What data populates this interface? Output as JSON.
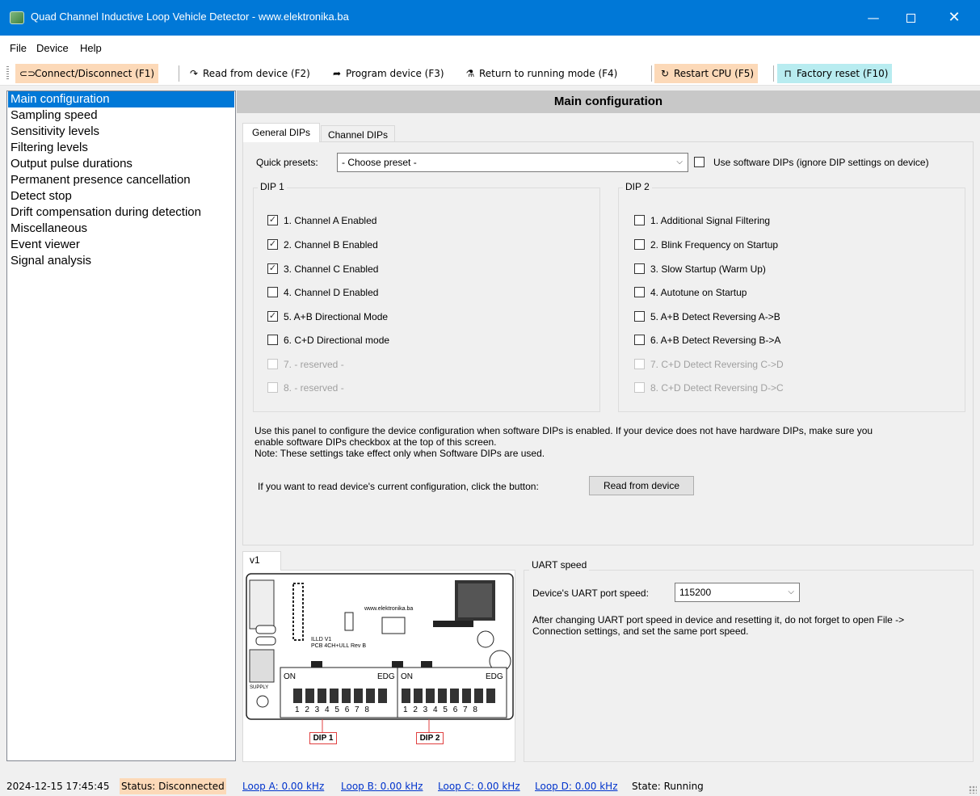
{
  "window": {
    "title": "Quad Channel Inductive Loop Vehicle Detector - www.elektronika.ba",
    "minimize_glyph": "—",
    "close_glyph": "✕"
  },
  "menu": [
    "File",
    "Device",
    "Help"
  ],
  "toolbar": {
    "buttons": [
      {
        "label": "Connect/Disconnect (F1)",
        "icon": "plug-icon",
        "bg": "#fcd9b8"
      },
      {
        "label": "Read from device (F2)",
        "icon": "redo-arrow-icon",
        "bg": "#ffffff"
      },
      {
        "label": "Program device (F3)",
        "icon": "program-icon",
        "bg": "#ffffff"
      },
      {
        "label": "Return to running mode (F4)",
        "icon": "flask-icon",
        "bg": "#ffffff"
      },
      {
        "label": "Restart CPU (F5)",
        "icon": "restart-icon",
        "bg": "#fcd9b8"
      },
      {
        "label": "Factory reset (F10)",
        "icon": "factory-reset-icon",
        "bg": "#b8ecf0"
      }
    ]
  },
  "sidebar": {
    "items": [
      "Main configuration",
      "Sampling speed",
      "Sensitivity levels",
      "Filtering levels",
      "Output pulse durations",
      "Permanent presence cancellation",
      "Detect stop",
      "Drift compensation during detection",
      "Miscellaneous",
      "Event viewer",
      "Signal analysis"
    ],
    "selected_index": 0
  },
  "main": {
    "header": "Main configuration",
    "tabs": [
      "General DIPs",
      "Channel DIPs"
    ],
    "active_tab": 0,
    "quick_presets_label": "Quick presets:",
    "quick_presets_value": "- Choose preset -",
    "software_dips_label": "Use software DIPs (ignore DIP settings on device)",
    "software_dips_checked": false,
    "dip1": {
      "title": "DIP 1",
      "items": [
        {
          "label": "1. Channel A Enabled",
          "checked": true,
          "enabled": true
        },
        {
          "label": "2. Channel B Enabled",
          "checked": true,
          "enabled": true
        },
        {
          "label": "3. Channel C Enabled",
          "checked": true,
          "enabled": true
        },
        {
          "label": "4. Channel D Enabled",
          "checked": false,
          "enabled": true
        },
        {
          "label": "5. A+B Directional Mode",
          "checked": true,
          "enabled": true
        },
        {
          "label": "6. C+D Directional mode",
          "checked": false,
          "enabled": true
        },
        {
          "label": "7. - reserved -",
          "checked": false,
          "enabled": false
        },
        {
          "label": "8. - reserved -",
          "checked": false,
          "enabled": false
        }
      ]
    },
    "dip2": {
      "title": "DIP 2",
      "items": [
        {
          "label": "1. Additional Signal Filtering",
          "checked": false,
          "enabled": true
        },
        {
          "label": "2. Blink Frequency on Startup",
          "checked": false,
          "enabled": true
        },
        {
          "label": "3. Slow Startup (Warm Up)",
          "checked": false,
          "enabled": true
        },
        {
          "label": "4. Autotune on Startup",
          "checked": false,
          "enabled": true
        },
        {
          "label": "5. A+B Detect Reversing A->B",
          "checked": false,
          "enabled": true
        },
        {
          "label": "6. A+B Detect Reversing B->A",
          "checked": false,
          "enabled": true
        },
        {
          "label": "7. C+D Detect Reversing C->D",
          "checked": false,
          "enabled": false
        },
        {
          "label": "8. C+D Detect Reversing D->C",
          "checked": false,
          "enabled": false
        }
      ]
    },
    "note_line1": "Use this panel to configure the device configuration when software DIPs is enabled. If your device does not have hardware DIPs, make sure you",
    "note_line2": "enable software DIPs checkbox at the top of this screen.",
    "note_line3": "Note: These settings take effect only when Software DIPs are used.",
    "read_prompt": "If you want to read device's current configuration, click the button:",
    "read_button": "Read from device"
  },
  "board": {
    "tab": "v1",
    "website": "www.elektronika.ba",
    "board_name": "ILLD V1",
    "board_text2": "PCB 4CH+ULL Rev B",
    "on_label": "ON",
    "edg_label": "EDG",
    "switch_numbers": "1 2 3 4 5 6 7 8",
    "supply_label": "SUPPLY",
    "dip1_label": "DIP 1",
    "dip2_label": "DIP 2"
  },
  "uart": {
    "group_title": "UART speed",
    "port_speed_label": "Device's UART port speed:",
    "port_speed_value": "115200",
    "note_line1": "After changing UART port speed in device and resetting it, do not forget to open File ->",
    "note_line2": "Connection settings, and set the same port speed."
  },
  "status": {
    "datetime": "2024-12-15 17:45:45",
    "status": "Status: Disconnected",
    "loop_a": "Loop A: 0.00 kHz",
    "loop_b": "Loop B: 0.00 kHz",
    "loop_c": "Loop C: 0.00 kHz",
    "loop_d": "Loop D: 0.00 kHz",
    "state": "State: Running"
  },
  "colors": {
    "titlebar": "#0078d7",
    "status_highlight": "#fcd9b8",
    "selection": "#0078d7"
  }
}
